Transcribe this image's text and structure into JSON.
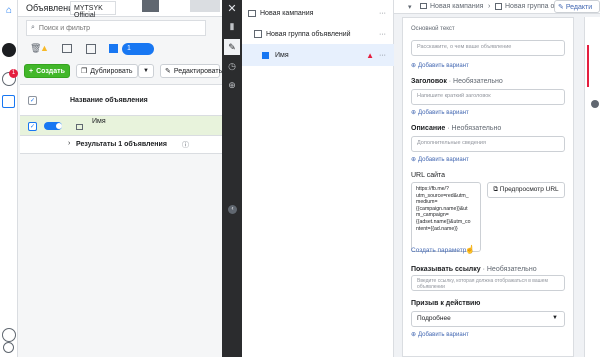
{
  "left_panel": {
    "title": "Объявления",
    "account": "MYTSYK Official",
    "search_placeholder": "Поиск и фильтр",
    "toolbar": {
      "create_label": "Создать",
      "duplicate_label": "Дублировать",
      "edit_label": "Редактировать",
      "count_badge": "1"
    },
    "table": {
      "header_label": "Название объявления",
      "row_name": "Имя",
      "results_label": "Результаты 1 объявления"
    }
  },
  "rail": {
    "badge": "1"
  },
  "tree": {
    "campaign": "Новая кампания",
    "adset": "Новая группа объявлений",
    "ad": "Имя",
    "more": "···"
  },
  "editor": {
    "breadcrumb_campaign": "Новая кампания",
    "breadcrumb_adset": "Новая группа объявлений",
    "edit_button": "Редакти",
    "primary_text_title": "Основной текст",
    "primary_text_placeholder": "Расскажите, о чем ваше объявление",
    "add_variant": "Добавить вариант",
    "headline_title": "Заголовок",
    "optional": "· Необязательно",
    "headline_placeholder": "Напишите краткий заголовок",
    "description_title": "Описание",
    "description_placeholder": "Дополнительные сведения",
    "url_title": "URL сайта",
    "url_lines": [
      "https://fb.me/?",
      "utm_source=red&utm_",
      "medium=",
      "{{campaign.name}}&ut",
      "m_campaign=",
      "{{adset.name}}&utm_co",
      "ntent={{ad.name}}"
    ],
    "preview_url": "Предпросмотр URL",
    "create_param": "Создать параметр",
    "display_link_title": "Показывать ссылку",
    "display_link_placeholder": "Введите ссылку, которая должна отображаться в вашем объявлении",
    "cta_title": "Призыв к действию",
    "cta_value": "Подробнее"
  },
  "colors": {
    "accent": "#4267b2",
    "green": "#42b72a",
    "warning": "#e41e3f",
    "dark_sidebar": "#2b2c2e"
  }
}
